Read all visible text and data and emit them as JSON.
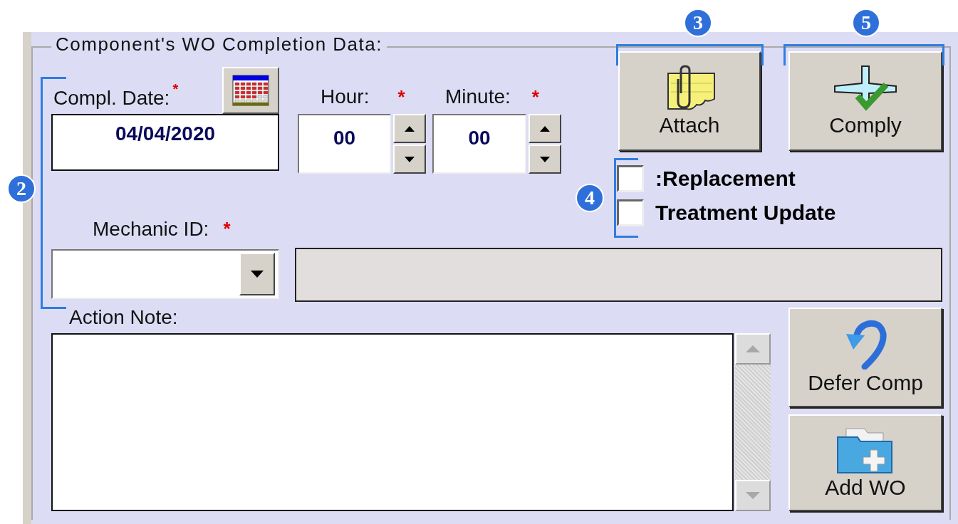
{
  "group_box": {
    "title": "Component's WO Completion Data:"
  },
  "compl_date": {
    "label": "Compl. Date:",
    "required_mark": "*",
    "value": "04/04/2020"
  },
  "hour": {
    "label": "Hour:",
    "required_mark": "*",
    "value": "00"
  },
  "minute": {
    "label": "Minute:",
    "required_mark": "*",
    "value": "00"
  },
  "mechanic_id": {
    "label": "Mechanic ID:",
    "required_mark": "*"
  },
  "action_note": {
    "label": "Action Note:"
  },
  "attach_button": {
    "label": "Attach"
  },
  "comply_button": {
    "label": "Comply"
  },
  "defer_button": {
    "label": "Defer Comp"
  },
  "add_wo_button": {
    "label": "Add WO"
  },
  "checkboxes": [
    {
      "label": ":Replacement",
      "checked": false
    },
    {
      "label": "Treatment Update",
      "checked": false
    }
  ],
  "callouts": [
    {
      "number": "2"
    },
    {
      "number": "3"
    },
    {
      "number": "4"
    },
    {
      "number": "5"
    }
  ]
}
